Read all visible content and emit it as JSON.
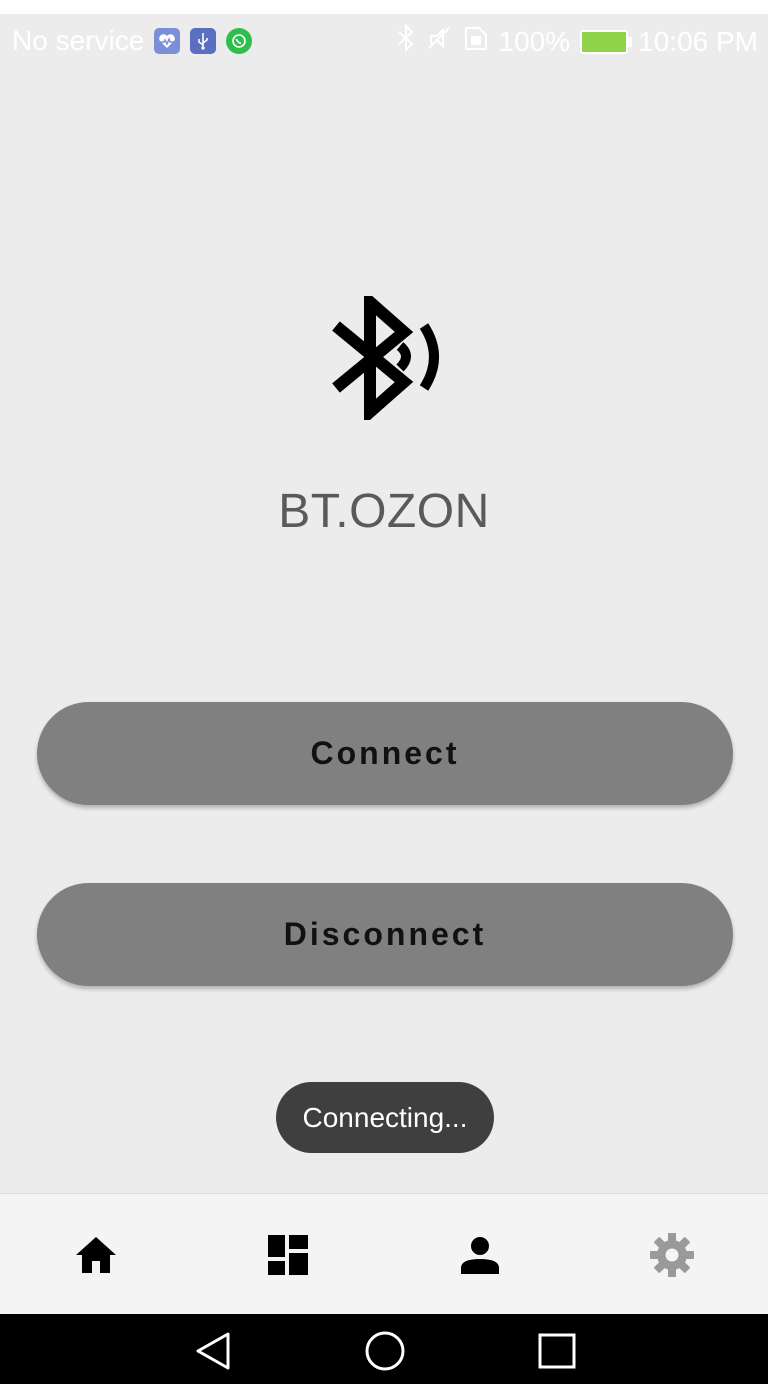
{
  "status_bar": {
    "carrier": "No service",
    "battery_percent": "100%",
    "time": "10:06 PM",
    "notification_icons": [
      "health-icon",
      "usb-icon",
      "whatsapp-icon"
    ],
    "system_icons": [
      "bluetooth-icon",
      "mute-icon",
      "sim-icon",
      "battery-charging-icon"
    ]
  },
  "main": {
    "device_name": "BT.OZON",
    "connect_label": "Connect",
    "disconnect_label": "Disconnect",
    "toast_text": "Connecting..."
  },
  "bottom_nav": {
    "items": [
      {
        "icon": "home-icon",
        "active": true
      },
      {
        "icon": "dashboard-icon",
        "active": false
      },
      {
        "icon": "person-icon",
        "active": false
      },
      {
        "icon": "settings-icon",
        "active": false
      }
    ]
  },
  "system_nav": {
    "buttons": [
      "back-icon",
      "home-circle-icon",
      "recents-icon"
    ]
  },
  "colors": {
    "background": "#ececec",
    "button_fill": "#808080",
    "toast_fill": "#3f3f3f",
    "battery_fill": "#8fd34a"
  }
}
